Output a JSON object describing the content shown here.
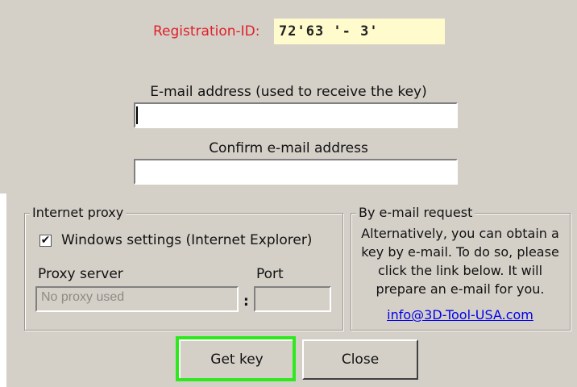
{
  "registration": {
    "label": "Registration-ID:",
    "value": "72'63  '- 3'"
  },
  "email": {
    "label": "E-mail address (used to receive the key)",
    "value": ""
  },
  "confirm_email": {
    "label": "Confirm e-mail address",
    "value": ""
  },
  "proxy": {
    "title": "Internet proxy",
    "windows_settings": {
      "label": "Windows settings (Internet Explorer)",
      "checked": true,
      "mark": "✔"
    },
    "server_label": "Proxy server",
    "server_placeholder": "No proxy used",
    "port_label": "Port",
    "separator": ":"
  },
  "email_request": {
    "title": "By e-mail request",
    "text": "Alternatively, you can obtain a key by e-mail. To do so, please click the link below. It will prepare an e-mail for you.",
    "link": "info@3D-Tool-USA.com"
  },
  "buttons": {
    "get_key": "Get key",
    "close": "Close"
  },
  "colors": {
    "highlight": "#2fe81e",
    "registration_label": "#e0202a",
    "registration_bg": "#fffbcc",
    "link": "#0000ee",
    "dialog_bg": "#d4d0c8"
  }
}
